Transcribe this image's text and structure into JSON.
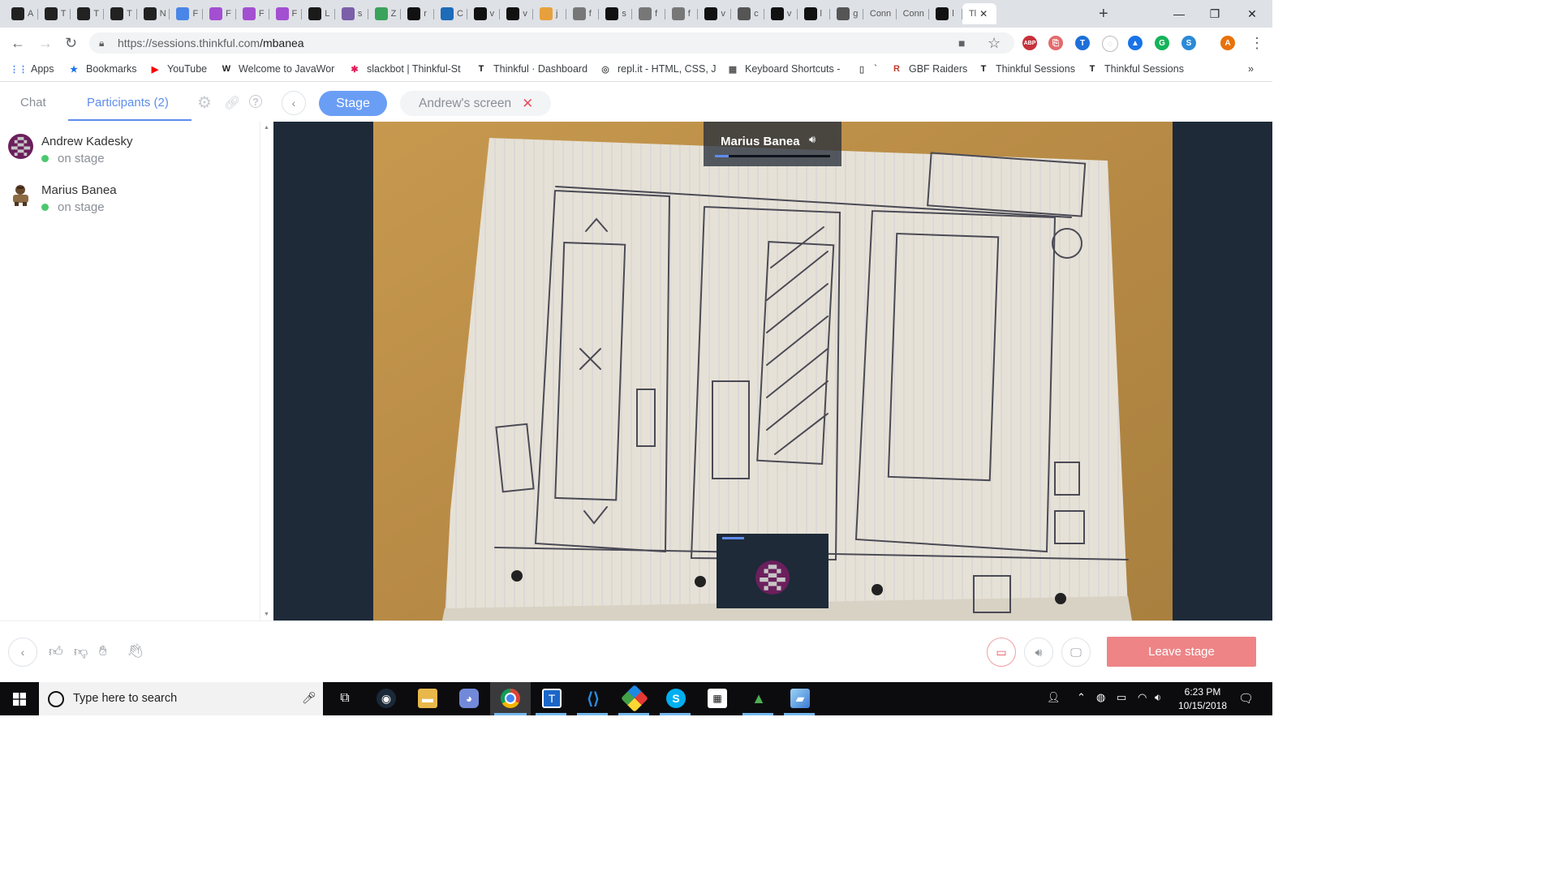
{
  "browser": {
    "tabs": [
      {
        "icon": "aol-icon",
        "label": "A",
        "color": "#222"
      },
      {
        "icon": "thinkful-icon",
        "label": "T",
        "color": "#222"
      },
      {
        "icon": "thinkful-icon",
        "label": "T",
        "color": "#222"
      },
      {
        "icon": "thinkful-icon",
        "label": "T",
        "color": "#222"
      },
      {
        "icon": "thinkful-icon",
        "label": "N",
        "color": "#222"
      },
      {
        "icon": "google-docs-icon",
        "label": "F",
        "color": "#4a86e8"
      },
      {
        "icon": "freecodecamp-icon",
        "label": "F",
        "color": "#a34fd1"
      },
      {
        "icon": "freecodecamp-icon",
        "label": "F",
        "color": "#a34fd1"
      },
      {
        "icon": "freecodecamp-icon",
        "label": "F",
        "color": "#a34fd1"
      },
      {
        "icon": "phone-icon",
        "label": "L",
        "color": "#1a1a1a"
      },
      {
        "icon": "h-icon",
        "label": "s",
        "color": "#7b5fa8"
      },
      {
        "icon": "gear-green-icon",
        "label": "Z",
        "color": "#3aa35b"
      },
      {
        "icon": "github-icon",
        "label": "r",
        "color": "#111"
      },
      {
        "icon": "cloud-icon",
        "label": "C",
        "color": "#1e6bb8"
      },
      {
        "icon": "github-icon",
        "label": "v",
        "color": "#111"
      },
      {
        "icon": "github-icon",
        "label": "v",
        "color": "#111"
      },
      {
        "icon": "hand-icon",
        "label": "j",
        "color": "#e7a03c"
      },
      {
        "icon": "page-icon",
        "label": "f",
        "color": "#777"
      },
      {
        "icon": "github-icon",
        "label": "s",
        "color": "#111"
      },
      {
        "icon": "page-icon",
        "label": "f",
        "color": "#777"
      },
      {
        "icon": "page-icon",
        "label": "f",
        "color": "#777"
      },
      {
        "icon": "github-icon",
        "label": "v",
        "color": "#111"
      },
      {
        "icon": "github-outline-icon",
        "label": "c",
        "color": "#555"
      },
      {
        "icon": "github-icon",
        "label": "v",
        "color": "#111"
      },
      {
        "icon": "ex-icon",
        "label": "l",
        "color": "#111"
      },
      {
        "icon": "github-outline-icon",
        "label": "g",
        "color": "#555"
      },
      {
        "icon": "none",
        "label": "Conn",
        "color": "#fff"
      },
      {
        "icon": "none",
        "label": "Conn",
        "color": "#fff"
      },
      {
        "icon": "github-icon",
        "label": "l",
        "color": "#111"
      }
    ],
    "active_tab": {
      "label": "Tl",
      "close": "✕"
    },
    "new_tab": "+",
    "window": {
      "minimize": "—",
      "maximize": "❐",
      "close": "✕"
    },
    "url_host": "https://sessions.thinkful.com",
    "url_path": "/mbanea",
    "extensions": [
      {
        "name": "abp-icon",
        "label": "ABP",
        "color": "#c7313b"
      },
      {
        "name": "pdf-icon",
        "label": "⎘",
        "color": "#e56a6a"
      },
      {
        "name": "thinkful-ext-icon",
        "label": "T",
        "color": "#1d6fd9"
      },
      {
        "name": "loading-ext-icon",
        "label": "◌",
        "color": "#bbb"
      },
      {
        "name": "drive-icon",
        "label": "▲",
        "color": "#1a73e8"
      },
      {
        "name": "grammarly-icon",
        "label": "G",
        "color": "#16b35a"
      },
      {
        "name": "s-ext-icon",
        "label": "S",
        "color": "#2b8ad7"
      },
      {
        "name": "profile-avatar",
        "label": "A",
        "color": "#e8710a"
      }
    ],
    "bookmarks": [
      {
        "icon": "apps-icon",
        "label": "Apps"
      },
      {
        "icon": "star-icon",
        "label": "Bookmarks"
      },
      {
        "icon": "youtube-icon",
        "label": "YouTube"
      },
      {
        "icon": "javaworld-icon",
        "label": "Welcome to JavaWor"
      },
      {
        "icon": "slack-icon",
        "label": "slackbot | Thinkful-St"
      },
      {
        "icon": "thinkful-icon",
        "label": "Thinkful · Dashboard"
      },
      {
        "icon": "replit-icon",
        "label": "repl.it - HTML, CSS, J"
      },
      {
        "icon": "keyboard-icon",
        "label": "Keyboard Shortcuts -"
      },
      {
        "icon": "page-icon",
        "label": "`"
      },
      {
        "icon": "gbf-icon",
        "label": "GBF Raiders"
      },
      {
        "icon": "thinkful-icon",
        "label": "Thinkful Sessions"
      },
      {
        "icon": "thinkful-icon",
        "label": "Thinkful Sessions"
      }
    ],
    "bookmarks_overflow": "»"
  },
  "app": {
    "side_tabs": {
      "chat": "Chat",
      "participants": "Participants (2)"
    },
    "stage_button": "Stage",
    "screen_pill": "Andrew's screen",
    "screen_pill_close": "✕",
    "participants": [
      {
        "name": "Andrew Kadesky",
        "status": "on stage"
      },
      {
        "name": "Marius Banea",
        "status": "on stage"
      }
    ],
    "speaker": {
      "name": "Marius Banea",
      "volume_level": 0.12
    },
    "leave_button": "Leave stage"
  },
  "taskbar": {
    "search_placeholder": "Type here to search",
    "time": "6:23 PM",
    "date": "10/15/2018"
  }
}
